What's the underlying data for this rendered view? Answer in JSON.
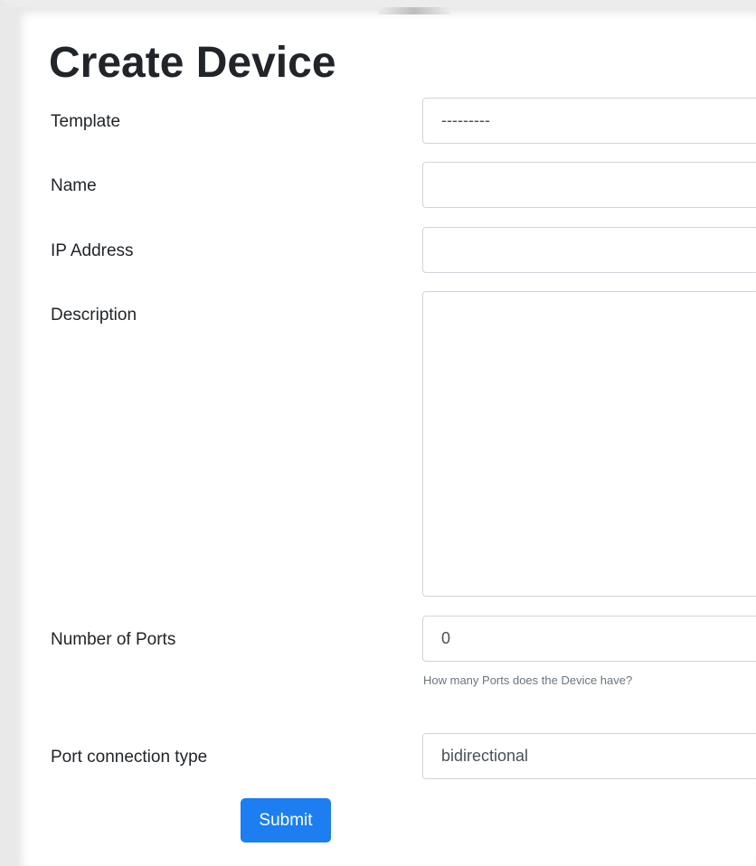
{
  "page": {
    "title": "Create Device"
  },
  "form": {
    "template": {
      "label": "Template",
      "value": "---------"
    },
    "name": {
      "label": "Name",
      "value": ""
    },
    "ip_address": {
      "label": "IP Address",
      "value": ""
    },
    "description": {
      "label": "Description",
      "value": ""
    },
    "number_of_ports": {
      "label": "Number of Ports",
      "value": "0",
      "help": "How many Ports does the Device have?"
    },
    "port_connection_type": {
      "label": "Port connection type",
      "value": "bidirectional"
    },
    "submit_label": "Submit"
  },
  "colors": {
    "primary": "#1c7ef0",
    "text": "#212529",
    "muted": "#6c757d",
    "border": "#ced4da"
  }
}
